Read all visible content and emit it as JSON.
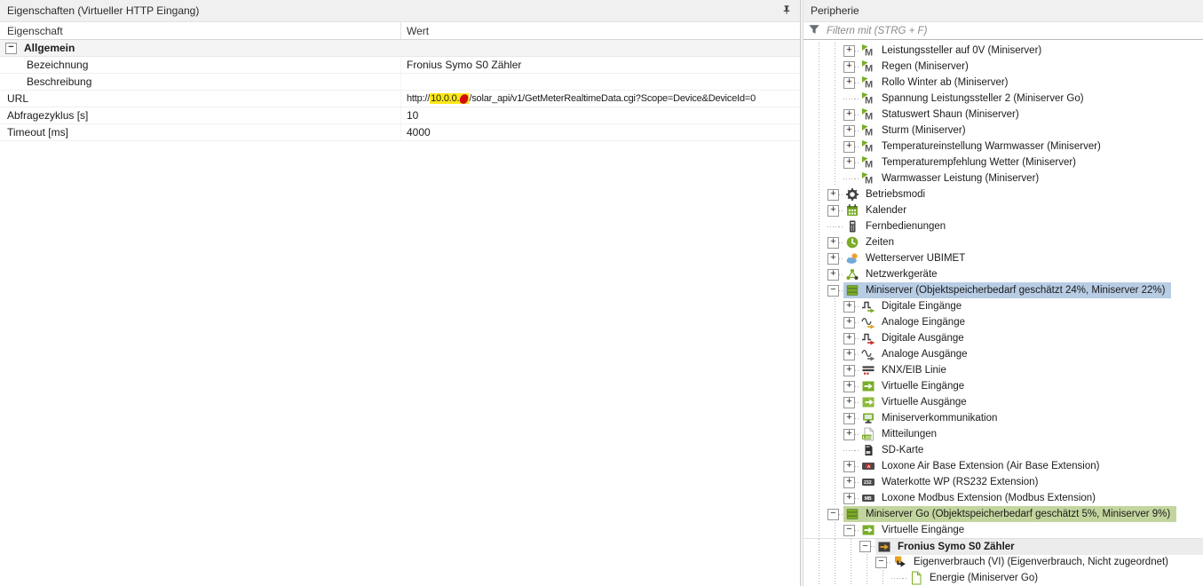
{
  "left_panel": {
    "title": "Eigenschaften (Virtueller HTTP Eingang)",
    "columns": [
      "Eigenschaft",
      "Wert"
    ],
    "group_label": "Allgemein",
    "rows": [
      {
        "name": "Bezeichnung",
        "indent": true,
        "value": "Fronius Symo S0 Zähler"
      },
      {
        "name": "Beschreibung",
        "indent": true,
        "value": ""
      },
      {
        "name": "URL",
        "indent": false,
        "value": {
          "prefix": "http://",
          "highlight": "10.0.0.",
          "redaction": true,
          "suffix": "/solar_api/v1/GetMeterRealtimeData.cgi?Scope=Device&DeviceId=0"
        }
      },
      {
        "name": "Abfragezyklus [s]",
        "indent": false,
        "value": "10"
      },
      {
        "name": "Timeout [ms]",
        "indent": false,
        "value": "4000"
      }
    ]
  },
  "right_panel": {
    "title": "Peripherie",
    "filter_placeholder": "Filtern mit (STRG + F)",
    "tree": [
      {
        "level": 2,
        "expand": "plus",
        "icon": "memory-flag",
        "label": "Leistungssteller auf 0V (Miniserver)"
      },
      {
        "level": 2,
        "expand": "plus",
        "icon": "memory-flag",
        "label": "Regen (Miniserver)"
      },
      {
        "level": 2,
        "expand": "plus",
        "icon": "memory-flag",
        "label": "Rollo Winter ab (Miniserver)"
      },
      {
        "level": 2,
        "expand": "none",
        "icon": "memory-flag",
        "label": "Spannung Leistungssteller 2 (Miniserver Go)"
      },
      {
        "level": 2,
        "expand": "plus",
        "icon": "memory-flag",
        "label": "Statuswert Shaun (Miniserver)"
      },
      {
        "level": 2,
        "expand": "plus",
        "icon": "memory-flag",
        "label": "Sturm (Miniserver)"
      },
      {
        "level": 2,
        "expand": "plus",
        "icon": "memory-flag",
        "label": "Temperatureinstellung Warmwasser (Miniserver)"
      },
      {
        "level": 2,
        "expand": "plus",
        "icon": "memory-flag",
        "label": "Temperaturempfehlung Wetter (Miniserver)"
      },
      {
        "level": 2,
        "expand": "none",
        "icon": "memory-flag",
        "label": "Warmwasser Leistung (Miniserver)"
      },
      {
        "level": 1,
        "expand": "plus",
        "icon": "gear",
        "label": "Betriebsmodi"
      },
      {
        "level": 1,
        "expand": "plus",
        "icon": "calendar",
        "label": "Kalender"
      },
      {
        "level": 1,
        "expand": "none",
        "icon": "remote",
        "label": "Fernbedienungen"
      },
      {
        "level": 1,
        "expand": "plus",
        "icon": "clock",
        "label": "Zeiten"
      },
      {
        "level": 1,
        "expand": "plus",
        "icon": "weather",
        "label": "Wetterserver UBIMET"
      },
      {
        "level": 1,
        "expand": "plus",
        "icon": "network",
        "label": "Netzwerkgeräte"
      },
      {
        "level": 1,
        "expand": "minus",
        "icon": "server",
        "label": "Miniserver (Objektspeicherbedarf geschätzt 24%, Miniserver 22%)",
        "highlight": "blue"
      },
      {
        "level": 2,
        "expand": "plus",
        "icon": "digital-in",
        "label": "Digitale Eingänge"
      },
      {
        "level": 2,
        "expand": "plus",
        "icon": "analog-in",
        "label": "Analoge Eingänge"
      },
      {
        "level": 2,
        "expand": "plus",
        "icon": "digital-out",
        "label": "Digitale Ausgänge"
      },
      {
        "level": 2,
        "expand": "plus",
        "icon": "analog-out",
        "label": "Analoge Ausgänge"
      },
      {
        "level": 2,
        "expand": "plus",
        "icon": "knx",
        "label": "KNX/EIB Linie"
      },
      {
        "level": 2,
        "expand": "plus",
        "icon": "virtual-in",
        "label": "Virtuelle Eingänge"
      },
      {
        "level": 2,
        "expand": "plus",
        "icon": "virtual-out",
        "label": "Virtuelle Ausgänge"
      },
      {
        "level": 2,
        "expand": "plus",
        "icon": "communication",
        "label": "Miniserverkommunikation"
      },
      {
        "level": 2,
        "expand": "plus",
        "icon": "log",
        "label": "Mitteilungen"
      },
      {
        "level": 2,
        "expand": "none",
        "icon": "sd-card",
        "label": "SD-Karte"
      },
      {
        "level": 2,
        "expand": "plus",
        "icon": "air-ext",
        "label": "Loxone Air Base Extension (Air Base Extension)"
      },
      {
        "level": 2,
        "expand": "plus",
        "icon": "rs232-ext",
        "label": "Waterkotte WP (RS232 Extension)"
      },
      {
        "level": 2,
        "expand": "plus",
        "icon": "modbus-ext",
        "label": "Loxone Modbus Extension (Modbus Extension)"
      },
      {
        "level": 1,
        "expand": "minus",
        "icon": "server",
        "label": "Miniserver Go (Objektspeicherbedarf geschätzt 5%, Miniserver 9%)",
        "highlight": "green"
      },
      {
        "level": 2,
        "expand": "minus",
        "icon": "virtual-in",
        "label": "Virtuelle Eingänge"
      },
      {
        "level": 3,
        "expand": "minus",
        "icon": "virtual-http",
        "label": "Fronius Symo S0 Zähler",
        "bold": true,
        "highlight": "gray"
      },
      {
        "level": 4,
        "expand": "minus",
        "icon": "command",
        "label": "Eigenverbrauch (VI) (Eigenverbrauch, Nicht zugeordnet)"
      },
      {
        "level": 5,
        "expand": "none",
        "icon": "document",
        "label": "Energie (Miniserver Go)"
      }
    ]
  },
  "colors": {
    "accent_green": "#7aad27",
    "selection_blue": "#b8cce4",
    "selection_green": "#c3d59e",
    "selection_gray": "#ececec",
    "highlight_yellow": "#ffe818",
    "redaction_red": "#d40b0b"
  }
}
